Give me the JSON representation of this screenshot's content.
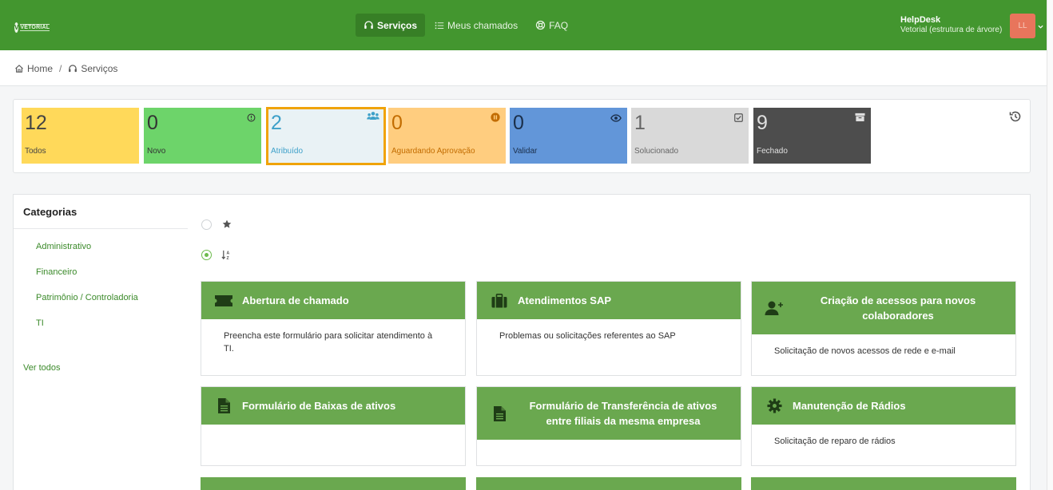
{
  "header": {
    "logo_text": "VETORIAL",
    "nav": [
      {
        "label": "Serviços",
        "icon": "headset-icon",
        "active": true
      },
      {
        "label": "Meus chamados",
        "icon": "list-icon",
        "active": false
      },
      {
        "label": "FAQ",
        "icon": "lifebuoy-icon",
        "active": false
      }
    ],
    "user": {
      "name": "HelpDesk",
      "entity": "Vetorial (estrutura de árvore)",
      "initials": "LL"
    }
  },
  "breadcrumb": {
    "home": "Home",
    "separator": "/",
    "current": "Serviços"
  },
  "tiles": [
    {
      "count": "12",
      "label": "Todos",
      "bg": "#ffd95a",
      "color": "#444"
    },
    {
      "count": "0",
      "label": "Novo",
      "bg": "#6dd46a",
      "color": "#333",
      "icon": "clock-circle-icon"
    },
    {
      "count": "2",
      "label": "Atribuído",
      "bg": "#e9f2f5",
      "color": "#3da0c9",
      "icon": "users-icon",
      "selected": true
    },
    {
      "count": "0",
      "label": "Aguardando Aprovação",
      "bg": "#ffcd7f",
      "color": "#c26c00",
      "icon": "pause-icon"
    },
    {
      "count": "0",
      "label": "Validar",
      "bg": "#6296d9",
      "color": "#1b2f4a",
      "icon": "eye-icon"
    },
    {
      "count": "1",
      "label": "Solucionado",
      "bg": "#d9d9d9",
      "color": "#666",
      "icon": "checkbox-icon"
    },
    {
      "count": "9",
      "label": "Fechado",
      "bg": "#4d4d4d",
      "color": "#e0e0e0",
      "icon": "archive-icon"
    }
  ],
  "sidebar": {
    "title": "Categorias",
    "categories": [
      "Administrativo",
      "Financeiro",
      "Patrimônio / Controladoria",
      "TI"
    ],
    "see_all": "Ver todos"
  },
  "cards": [
    {
      "title": "Abertura de chamado",
      "description": "Preencha este formulário para solicitar atendimento à TI.",
      "icon": "ticket-icon"
    },
    {
      "title": "Atendimentos SAP",
      "description": "Problemas ou solicitações referentes ao SAP",
      "icon": "briefcase-icon"
    },
    {
      "title": "Criação de acessos para novos colaboradores",
      "description": "Solicitação de novos acessos de rede e e-mail",
      "icon": "user-plus-icon"
    },
    {
      "title": "Formulário de Baixas de ativos",
      "description": "",
      "icon": "document-icon"
    },
    {
      "title": "Formulário de Transferência de ativos entre filiais da mesma empresa",
      "description": "",
      "icon": "document-icon"
    },
    {
      "title": "Manutenção de Rádios",
      "description": "Solicitação de reparo de rádios",
      "icon": "gear-icon"
    }
  ],
  "colors": {
    "brand": "#43962f",
    "card_header": "#6aa84f",
    "link": "#3b8a2a",
    "selected_border": "#f0a30a"
  }
}
